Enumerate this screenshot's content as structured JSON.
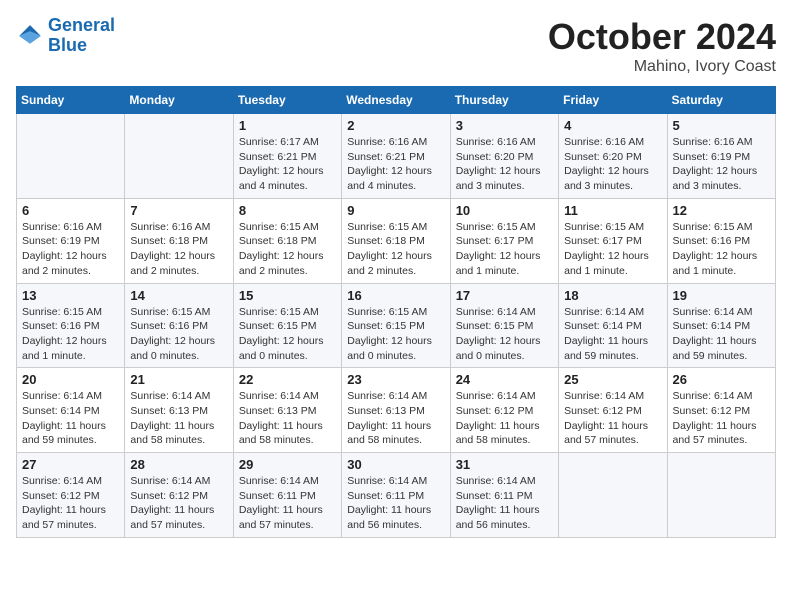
{
  "header": {
    "logo_line1": "General",
    "logo_line2": "Blue",
    "month": "October 2024",
    "location": "Mahino, Ivory Coast"
  },
  "weekdays": [
    "Sunday",
    "Monday",
    "Tuesday",
    "Wednesday",
    "Thursday",
    "Friday",
    "Saturday"
  ],
  "weeks": [
    [
      {
        "day": "",
        "info": ""
      },
      {
        "day": "",
        "info": ""
      },
      {
        "day": "1",
        "info": "Sunrise: 6:17 AM\nSunset: 6:21 PM\nDaylight: 12 hours and 4 minutes."
      },
      {
        "day": "2",
        "info": "Sunrise: 6:16 AM\nSunset: 6:21 PM\nDaylight: 12 hours and 4 minutes."
      },
      {
        "day": "3",
        "info": "Sunrise: 6:16 AM\nSunset: 6:20 PM\nDaylight: 12 hours and 3 minutes."
      },
      {
        "day": "4",
        "info": "Sunrise: 6:16 AM\nSunset: 6:20 PM\nDaylight: 12 hours and 3 minutes."
      },
      {
        "day": "5",
        "info": "Sunrise: 6:16 AM\nSunset: 6:19 PM\nDaylight: 12 hours and 3 minutes."
      }
    ],
    [
      {
        "day": "6",
        "info": "Sunrise: 6:16 AM\nSunset: 6:19 PM\nDaylight: 12 hours and 2 minutes."
      },
      {
        "day": "7",
        "info": "Sunrise: 6:16 AM\nSunset: 6:18 PM\nDaylight: 12 hours and 2 minutes."
      },
      {
        "day": "8",
        "info": "Sunrise: 6:15 AM\nSunset: 6:18 PM\nDaylight: 12 hours and 2 minutes."
      },
      {
        "day": "9",
        "info": "Sunrise: 6:15 AM\nSunset: 6:18 PM\nDaylight: 12 hours and 2 minutes."
      },
      {
        "day": "10",
        "info": "Sunrise: 6:15 AM\nSunset: 6:17 PM\nDaylight: 12 hours and 1 minute."
      },
      {
        "day": "11",
        "info": "Sunrise: 6:15 AM\nSunset: 6:17 PM\nDaylight: 12 hours and 1 minute."
      },
      {
        "day": "12",
        "info": "Sunrise: 6:15 AM\nSunset: 6:16 PM\nDaylight: 12 hours and 1 minute."
      }
    ],
    [
      {
        "day": "13",
        "info": "Sunrise: 6:15 AM\nSunset: 6:16 PM\nDaylight: 12 hours and 1 minute."
      },
      {
        "day": "14",
        "info": "Sunrise: 6:15 AM\nSunset: 6:16 PM\nDaylight: 12 hours and 0 minutes."
      },
      {
        "day": "15",
        "info": "Sunrise: 6:15 AM\nSunset: 6:15 PM\nDaylight: 12 hours and 0 minutes."
      },
      {
        "day": "16",
        "info": "Sunrise: 6:15 AM\nSunset: 6:15 PM\nDaylight: 12 hours and 0 minutes."
      },
      {
        "day": "17",
        "info": "Sunrise: 6:14 AM\nSunset: 6:15 PM\nDaylight: 12 hours and 0 minutes."
      },
      {
        "day": "18",
        "info": "Sunrise: 6:14 AM\nSunset: 6:14 PM\nDaylight: 11 hours and 59 minutes."
      },
      {
        "day": "19",
        "info": "Sunrise: 6:14 AM\nSunset: 6:14 PM\nDaylight: 11 hours and 59 minutes."
      }
    ],
    [
      {
        "day": "20",
        "info": "Sunrise: 6:14 AM\nSunset: 6:14 PM\nDaylight: 11 hours and 59 minutes."
      },
      {
        "day": "21",
        "info": "Sunrise: 6:14 AM\nSunset: 6:13 PM\nDaylight: 11 hours and 58 minutes."
      },
      {
        "day": "22",
        "info": "Sunrise: 6:14 AM\nSunset: 6:13 PM\nDaylight: 11 hours and 58 minutes."
      },
      {
        "day": "23",
        "info": "Sunrise: 6:14 AM\nSunset: 6:13 PM\nDaylight: 11 hours and 58 minutes."
      },
      {
        "day": "24",
        "info": "Sunrise: 6:14 AM\nSunset: 6:12 PM\nDaylight: 11 hours and 58 minutes."
      },
      {
        "day": "25",
        "info": "Sunrise: 6:14 AM\nSunset: 6:12 PM\nDaylight: 11 hours and 57 minutes."
      },
      {
        "day": "26",
        "info": "Sunrise: 6:14 AM\nSunset: 6:12 PM\nDaylight: 11 hours and 57 minutes."
      }
    ],
    [
      {
        "day": "27",
        "info": "Sunrise: 6:14 AM\nSunset: 6:12 PM\nDaylight: 11 hours and 57 minutes."
      },
      {
        "day": "28",
        "info": "Sunrise: 6:14 AM\nSunset: 6:12 PM\nDaylight: 11 hours and 57 minutes."
      },
      {
        "day": "29",
        "info": "Sunrise: 6:14 AM\nSunset: 6:11 PM\nDaylight: 11 hours and 57 minutes."
      },
      {
        "day": "30",
        "info": "Sunrise: 6:14 AM\nSunset: 6:11 PM\nDaylight: 11 hours and 56 minutes."
      },
      {
        "day": "31",
        "info": "Sunrise: 6:14 AM\nSunset: 6:11 PM\nDaylight: 11 hours and 56 minutes."
      },
      {
        "day": "",
        "info": ""
      },
      {
        "day": "",
        "info": ""
      }
    ]
  ]
}
